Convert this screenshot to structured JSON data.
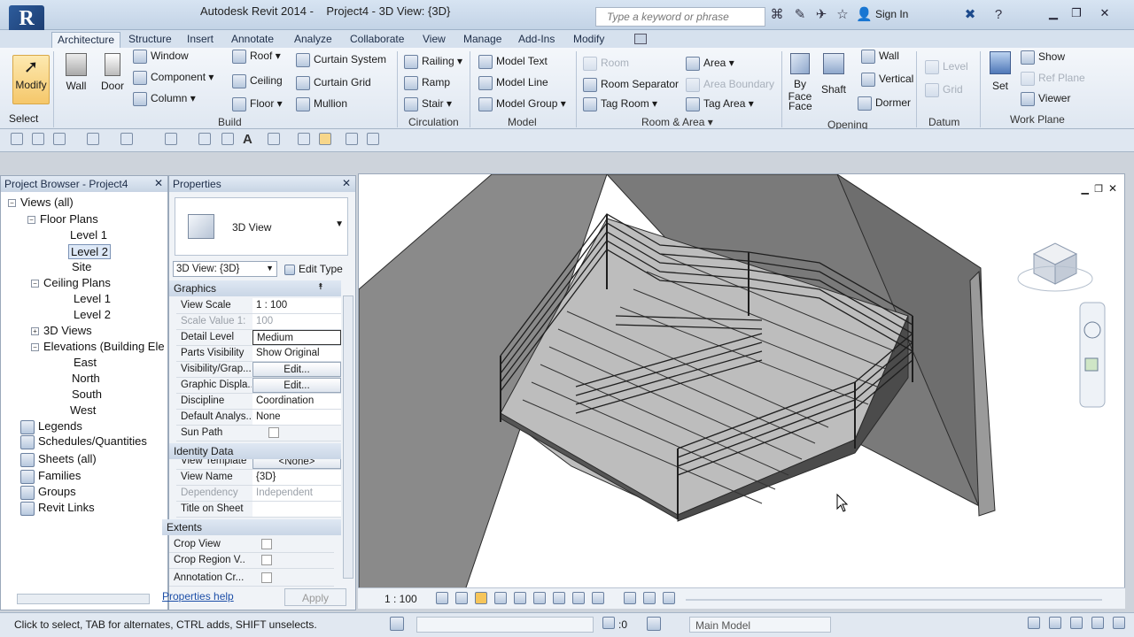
{
  "app": {
    "title": "Autodesk Revit 2014 -",
    "doc_title": "Project4 - 3D View: {3D}"
  },
  "search": {
    "placeholder": "Type a keyword or phrase"
  },
  "titlebar": {
    "signin": "Sign In"
  },
  "tabs": [
    "Architecture",
    "Structure",
    "Insert",
    "Annotate",
    "Analyze",
    "Collaborate",
    "View",
    "Manage",
    "Add-Ins",
    "Modify"
  ],
  "ribbon": {
    "select": {
      "modify": "Modify",
      "select": "Select"
    },
    "build": {
      "wall": "Wall",
      "door": "Door",
      "window": "Window",
      "component": "Component",
      "column": "Column",
      "roof": "Roof",
      "ceiling": "Ceiling",
      "floor": "Floor",
      "curtain_system": "Curtain System",
      "curtain_grid": "Curtain Grid",
      "mullion": "Mullion",
      "panel": "Build"
    },
    "circulation": {
      "railing": "Railing",
      "ramp": "Ramp",
      "stair": "Stair",
      "panel": "Circulation"
    },
    "model": {
      "model_text": "Model Text",
      "model_line": "Model Line",
      "model_group": "Model Group",
      "panel": "Model"
    },
    "room": {
      "room": "Room",
      "room_separator": "Room Separator",
      "tag_room": "Tag Room",
      "area": "Area",
      "area_boundary": "Area Boundary",
      "tag_area": "Tag Area",
      "panel": "Room & Area"
    },
    "opening": {
      "by_face": "By Face",
      "by_face2": "Face",
      "shaft": "Shaft",
      "wall": "Wall",
      "vertical": "Vertical",
      "dormer": "Dormer",
      "panel": "Opening"
    },
    "datum": {
      "level": "Level",
      "grid": "Grid",
      "panel": "Datum"
    },
    "workplane": {
      "set": "Set",
      "show": "Show",
      "ref_plane": "Ref Plane",
      "viewer": "Viewer",
      "panel": "Work Plane"
    }
  },
  "browser": {
    "title": "Project Browser - Project4",
    "items": [
      "Views (all)",
      "Floor Plans",
      "Level 1",
      "Level 2",
      "Site",
      "Ceiling Plans",
      "Level 1",
      "Level 2",
      "3D Views",
      "Elevations (Building Ele",
      "East",
      "North",
      "South",
      "West",
      "Legends",
      "Schedules/Quantities",
      "Sheets (all)",
      "Families",
      "Groups",
      "Revit Links"
    ]
  },
  "properties": {
    "title": "Properties",
    "type_name": "3D View",
    "selector": "3D View: {3D}",
    "edit_type": "Edit Type",
    "sections": {
      "graphics": "Graphics",
      "identity": "Identity Data",
      "extents": "Extents"
    },
    "rows": [
      {
        "k": "View Scale",
        "v": "1 : 100"
      },
      {
        "k": "Scale Value  1:",
        "v": "100"
      },
      {
        "k": "Detail Level",
        "v": "Medium"
      },
      {
        "k": "Parts Visibility",
        "v": "Show Original"
      },
      {
        "k": "Visibility/Grap...",
        "v": "Edit..."
      },
      {
        "k": "Graphic Displa...",
        "v": "Edit..."
      },
      {
        "k": "Discipline",
        "v": "Coordination"
      },
      {
        "k": "Default Analys...",
        "v": "None"
      },
      {
        "k": "Sun Path",
        "v": ""
      },
      {
        "k": "View Template",
        "v": "<None>"
      },
      {
        "k": "View Name",
        "v": "{3D}"
      },
      {
        "k": "Dependency",
        "v": "Independent"
      },
      {
        "k": "Title on Sheet",
        "v": ""
      },
      {
        "k": "Crop View",
        "v": ""
      },
      {
        "k": "Crop Region V...",
        "v": ""
      },
      {
        "k": "Annotation Cr...",
        "v": ""
      }
    ],
    "help": "Properties help",
    "apply": "Apply"
  },
  "viewbar": {
    "scale": "1 : 100"
  },
  "status": {
    "hint": "Click to select, TAB for alternates, CTRL adds, SHIFT unselects.",
    "count": ":0",
    "model": "Main Model"
  }
}
